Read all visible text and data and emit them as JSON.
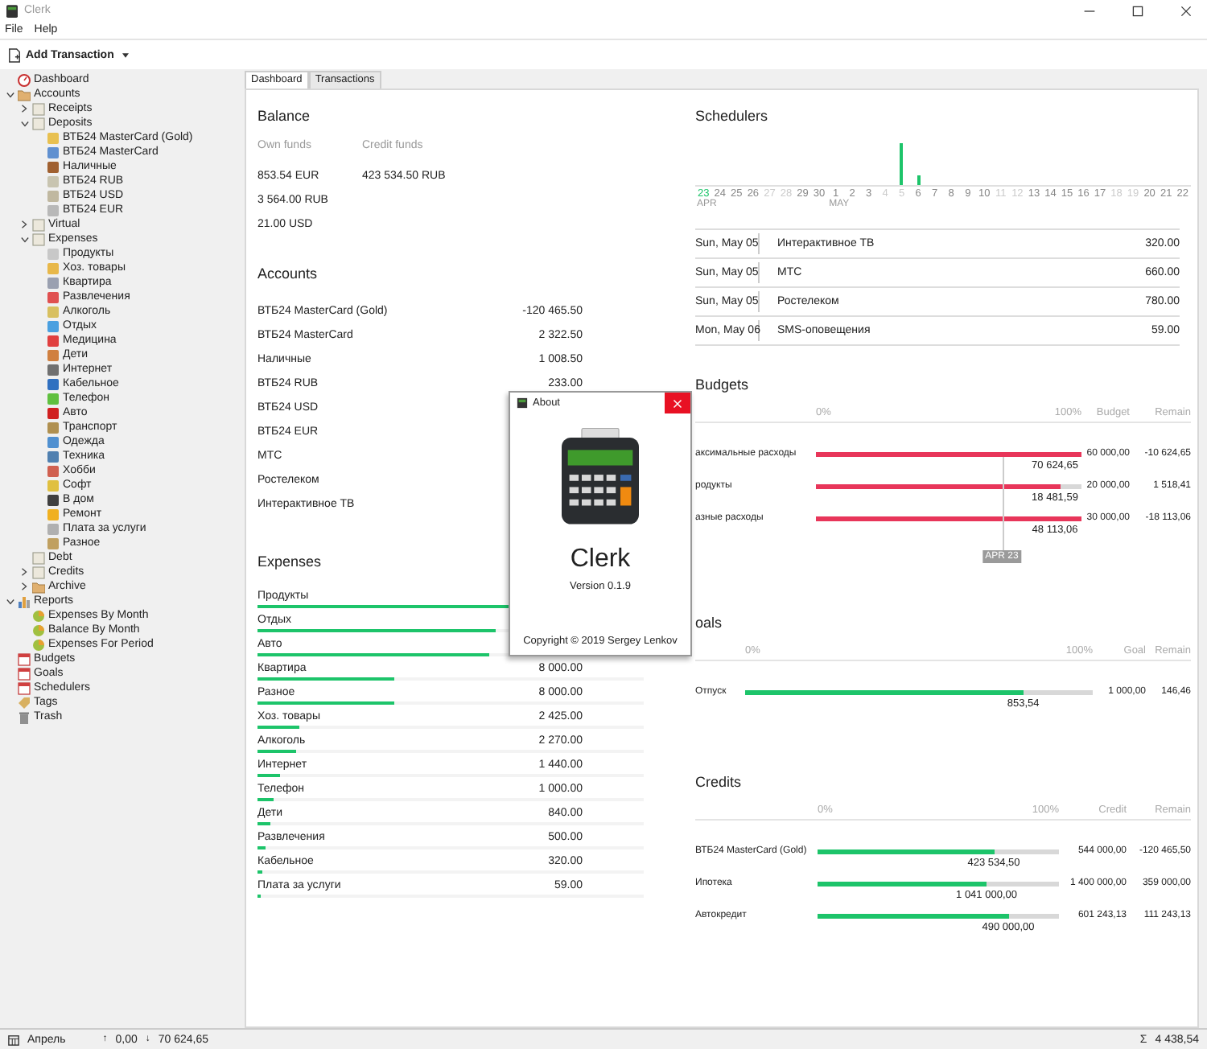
{
  "window": {
    "title": "Clerk"
  },
  "menu": [
    "File",
    "Help"
  ],
  "toolbar": {
    "add_button": "Add Transaction"
  },
  "sidebar": {
    "tree": [
      {
        "label": "Dashboard",
        "kind": "dashboard"
      },
      {
        "label": "Accounts",
        "kind": "folder",
        "expanded": true,
        "children": [
          {
            "label": "Receipts",
            "kind": "book",
            "expanded": false
          },
          {
            "label": "Deposits",
            "kind": "book",
            "expanded": true,
            "children": [
              {
                "label": "ВТБ24 MasterCard (Gold)",
                "kind": "swatch",
                "color": "#e8c050"
              },
              {
                "label": "ВТБ24 MasterCard",
                "kind": "swatch",
                "color": "#6090d0"
              },
              {
                "label": "Наличные",
                "kind": "swatch",
                "color": "#a06030"
              },
              {
                "label": "ВТБ24 RUB",
                "kind": "swatch",
                "color": "#c8c4b0"
              },
              {
                "label": "ВТБ24 USD",
                "kind": "swatch",
                "color": "#c0b8a0"
              },
              {
                "label": "ВТБ24 EUR",
                "kind": "swatch",
                "color": "#b8b8b8"
              }
            ]
          },
          {
            "label": "Virtual",
            "kind": "book",
            "expanded": false
          },
          {
            "label": "Expenses",
            "kind": "book",
            "expanded": true,
            "children": [
              {
                "label": "Продукты",
                "kind": "swatch",
                "color": "#c8c8c8"
              },
              {
                "label": "Хоз. товары",
                "kind": "swatch",
                "color": "#e8b84a"
              },
              {
                "label": "Квартира",
                "kind": "swatch",
                "color": "#9aa0b0"
              },
              {
                "label": "Развлечения",
                "kind": "swatch",
                "color": "#e05050"
              },
              {
                "label": "Алкоголь",
                "kind": "swatch",
                "color": "#d8c060"
              },
              {
                "label": "Отдых",
                "kind": "swatch",
                "color": "#4aa0e0"
              },
              {
                "label": "Медицина",
                "kind": "swatch",
                "color": "#e04040"
              },
              {
                "label": "Дети",
                "kind": "swatch",
                "color": "#d08040"
              },
              {
                "label": "Интернет",
                "kind": "swatch",
                "color": "#707070"
              },
              {
                "label": "Кабельное",
                "kind": "swatch",
                "color": "#3070c0"
              },
              {
                "label": "Телефон",
                "kind": "swatch",
                "color": "#60c040"
              },
              {
                "label": "Авто",
                "kind": "swatch",
                "color": "#d02020"
              },
              {
                "label": "Транспорт",
                "kind": "swatch",
                "color": "#b09050"
              },
              {
                "label": "Одежда",
                "kind": "swatch",
                "color": "#5090d0"
              },
              {
                "label": "Техника",
                "kind": "swatch",
                "color": "#5080b0"
              },
              {
                "label": "Хобби",
                "kind": "swatch",
                "color": "#d06050"
              },
              {
                "label": "Софт",
                "kind": "swatch",
                "color": "#e0c040"
              },
              {
                "label": "В дом",
                "kind": "swatch",
                "color": "#404040"
              },
              {
                "label": "Ремонт",
                "kind": "swatch",
                "color": "#f0b020"
              },
              {
                "label": "Плата за услуги",
                "kind": "swatch",
                "color": "#b0b0b0"
              },
              {
                "label": "Разное",
                "kind": "swatch",
                "color": "#c0a060"
              }
            ]
          },
          {
            "label": "Debt",
            "kind": "book"
          },
          {
            "label": "Credits",
            "kind": "book",
            "expanded": false
          },
          {
            "label": "Archive",
            "kind": "folder",
            "expanded": false
          }
        ]
      },
      {
        "label": "Reports",
        "kind": "report",
        "expanded": true,
        "children": [
          {
            "label": "Expenses By Month",
            "kind": "ball"
          },
          {
            "label": "Balance By Month",
            "kind": "ball"
          },
          {
            "label": "Expenses For Period",
            "kind": "ball"
          }
        ]
      },
      {
        "label": "Budgets",
        "kind": "calendar"
      },
      {
        "label": "Goals",
        "kind": "calendar"
      },
      {
        "label": "Schedulers",
        "kind": "calendar"
      },
      {
        "label": "Tags",
        "kind": "tag"
      },
      {
        "label": "Trash",
        "kind": "trash"
      }
    ]
  },
  "tabs": [
    {
      "label": "Dashboard",
      "selected": true
    },
    {
      "label": "Transactions",
      "selected": false
    }
  ],
  "balance": {
    "title": "Balance",
    "columns": [
      {
        "label": "Own funds",
        "values": [
          "853.54 EUR",
          "3 564.00 RUB",
          "21.00 USD"
        ]
      },
      {
        "label": "Credit funds",
        "values": [
          "423 534.50 RUB"
        ]
      }
    ]
  },
  "accounts": {
    "title": "Accounts",
    "rows": [
      {
        "name": "ВТБ24 MasterCard (Gold)",
        "amount": "-120 465.50"
      },
      {
        "name": "ВТБ24 MasterCard",
        "amount": "2 322.50"
      },
      {
        "name": "Наличные",
        "amount": "1 008.50"
      },
      {
        "name": "ВТБ24 RUB",
        "amount": "233.00"
      },
      {
        "name": "ВТБ24 USD"
      },
      {
        "name": "ВТБ24 EUR"
      },
      {
        "name": "МТС"
      },
      {
        "name": "Ростелеком"
      },
      {
        "name": "Интерактивное ТВ"
      }
    ]
  },
  "expenses": {
    "title": "Expenses",
    "rows": [
      {
        "name": "Продукты",
        "level": 0.7
      },
      {
        "name": "Отдых",
        "level": 0.617
      },
      {
        "name": "Авто",
        "level": 0.6
      },
      {
        "name": "Квартира",
        "amount": "8 000.00",
        "level": 0.354
      },
      {
        "name": "Разное",
        "amount": "8 000.00",
        "level": 0.354
      },
      {
        "name": "Хоз. товары",
        "amount": "2 425.00",
        "level": 0.108
      },
      {
        "name": "Алкоголь",
        "amount": "2 270.00",
        "level": 0.1
      },
      {
        "name": "Интернет",
        "amount": "1 440.00",
        "level": 0.058
      },
      {
        "name": "Телефон",
        "amount": "1 000.00",
        "level": 0.042
      },
      {
        "name": "Дети",
        "amount": "840.00",
        "level": 0.033
      },
      {
        "name": "Развлечения",
        "amount": "500.00",
        "level": 0.02
      },
      {
        "name": "Кабельное",
        "amount": "320.00",
        "level": 0.013
      },
      {
        "name": "Плата за услуги",
        "amount": "59.00",
        "level": 0.008
      }
    ]
  },
  "schedulers": {
    "title": "Schedulers",
    "days": [
      {
        "label": "23",
        "month": "APR",
        "selected": true,
        "weekend": false
      },
      {
        "label": "24",
        "selected": false,
        "weekend": false
      },
      {
        "label": "25",
        "selected": false,
        "weekend": false
      },
      {
        "label": "26",
        "selected": false,
        "weekend": false
      },
      {
        "label": "27",
        "selected": false,
        "weekend": true
      },
      {
        "label": "28",
        "selected": false,
        "weekend": true
      },
      {
        "label": "29",
        "selected": false,
        "weekend": false
      },
      {
        "label": "30",
        "selected": false,
        "weekend": false
      },
      {
        "label": "1",
        "month": "MAY",
        "selected": false,
        "weekend": false
      },
      {
        "label": "2",
        "selected": false,
        "weekend": false
      },
      {
        "label": "3",
        "selected": false,
        "weekend": false
      },
      {
        "label": "4",
        "selected": false,
        "weekend": true
      },
      {
        "label": "5",
        "selected": false,
        "weekend": true,
        "level": 1
      },
      {
        "label": "6",
        "selected": false,
        "weekend": false,
        "level": 0.24
      },
      {
        "label": "7",
        "selected": false,
        "weekend": false
      },
      {
        "label": "8",
        "selected": false,
        "weekend": false
      },
      {
        "label": "9",
        "selected": false,
        "weekend": false
      },
      {
        "label": "10",
        "selected": false,
        "weekend": false
      },
      {
        "label": "11",
        "selected": false,
        "weekend": true
      },
      {
        "label": "12",
        "selected": false,
        "weekend": true
      },
      {
        "label": "13",
        "selected": false,
        "weekend": false
      },
      {
        "label": "14",
        "selected": false,
        "weekend": false
      },
      {
        "label": "15",
        "selected": false,
        "weekend": false
      },
      {
        "label": "16",
        "selected": false,
        "weekend": false
      },
      {
        "label": "17",
        "selected": false,
        "weekend": false
      },
      {
        "label": "18",
        "selected": false,
        "weekend": true
      },
      {
        "label": "19",
        "selected": false,
        "weekend": true
      },
      {
        "label": "20",
        "selected": false,
        "weekend": false
      },
      {
        "label": "21",
        "selected": false,
        "weekend": false
      },
      {
        "label": "22",
        "selected": false,
        "weekend": false
      }
    ],
    "rows": [
      {
        "date": "Sun, May 05",
        "name": "Интерактивное ТВ",
        "amount": "320.00"
      },
      {
        "date": "Sun, May 05",
        "name": "МТС",
        "amount": "660.00"
      },
      {
        "date": "Sun, May 05",
        "name": "Ростелеком",
        "amount": "780.00"
      },
      {
        "date": "Mon, May 06",
        "name": "SMS-оповещения",
        "amount": "59.00"
      }
    ]
  },
  "progress_sections": [
    {
      "kind": "budget",
      "title": "Budgets",
      "header": [
        "0%",
        "100%",
        "Budget",
        "Remain"
      ],
      "marker": {
        "label": "APR 23",
        "level": 0.7
      },
      "rows": [
        {
          "name": "аксимальные расходы",
          "level": 1,
          "spent": "70 624,65",
          "total": "60 000,00",
          "remain": "-10 624,65"
        },
        {
          "name": "родукты",
          "level": 0.924,
          "spent": "18 481,59",
          "total": "20 000,00",
          "remain": "1 518,41"
        },
        {
          "name": "азные расходы",
          "level": 1,
          "spent": "48 113,06",
          "total": "30 000,00",
          "remain": "-18 113,06"
        }
      ]
    },
    {
      "kind": "goal",
      "title": "oals",
      "header": [
        "0%",
        "100%",
        "Goal",
        "Remain"
      ],
      "rows": [
        {
          "name": "Отпуск",
          "level": 0.8,
          "spent": "853,54",
          "total": "1 000,00",
          "remain": "146,46"
        }
      ]
    },
    {
      "kind": "credit",
      "title": "Credits",
      "header": [
        "0%",
        "100%",
        "Credit",
        "Remain"
      ],
      "rows": [
        {
          "name": "ВТБ24 MasterCard (Gold)",
          "level": 0.73,
          "spent": "423 534,50",
          "total": "544 000,00",
          "remain": "-120 465,50"
        },
        {
          "name": "Ипотека",
          "level": 0.7,
          "spent": "1 041 000,00",
          "total": "1 400 000,00",
          "remain": "359 000,00"
        },
        {
          "name": "Автокредит",
          "level": 0.79,
          "spent": "490 000,00",
          "total": "601 243,13",
          "remain": "111 243,13"
        }
      ]
    }
  ],
  "about_dialog": {
    "title": "About",
    "app_name": "Clerk",
    "version": "Version 0.1.9",
    "copyright": "Copyright © 2019 Sergey Lenkov"
  },
  "status_bar": {
    "month": "Апрель",
    "income_sign": "↑",
    "income": "0,00",
    "expense_sign": "↓",
    "expense": "70 624,65",
    "total_sign": "Σ",
    "total": "4 438,54"
  }
}
